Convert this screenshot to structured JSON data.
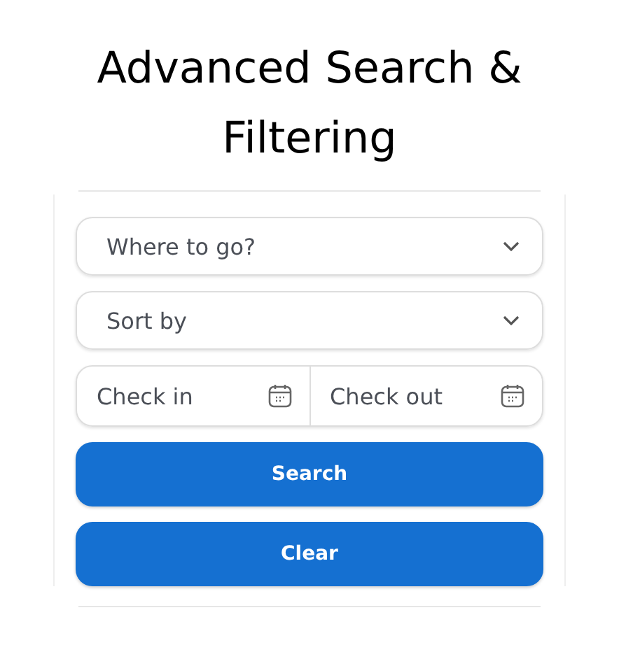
{
  "title": "Advanced Search & Filtering",
  "selects": [
    {
      "placeholder": "Where to go?"
    },
    {
      "placeholder": "Sort by"
    }
  ],
  "dates": [
    {
      "placeholder": "Check in"
    },
    {
      "placeholder": "Check out"
    }
  ],
  "buttons": [
    "Search",
    "Clear"
  ]
}
